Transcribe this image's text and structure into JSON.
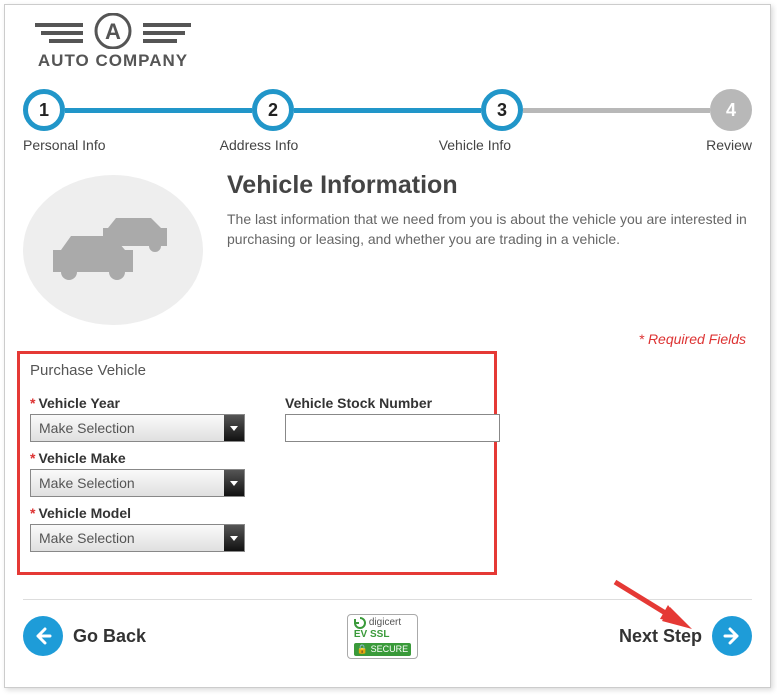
{
  "logo": {
    "text": "AUTO COMPANY"
  },
  "stepper": {
    "steps": [
      {
        "num": "1",
        "label": "Personal Info",
        "active": true
      },
      {
        "num": "2",
        "label": "Address Info",
        "active": true
      },
      {
        "num": "3",
        "label": "Vehicle Info",
        "active": true
      },
      {
        "num": "4",
        "label": "Review",
        "active": false
      }
    ]
  },
  "heading": "Vehicle Information",
  "description": "The last information that we need from you is about the vehicle you are interested in purchasing or leasing, and whether you are trading in a vehicle.",
  "required_note": "* Required Fields",
  "form": {
    "section_title": "Purchase Vehicle",
    "year": {
      "label": "Vehicle Year",
      "value": "Make Selection"
    },
    "make": {
      "label": "Vehicle Make",
      "value": "Make Selection"
    },
    "model": {
      "label": "Vehicle Model",
      "value": "Make Selection"
    },
    "stock": {
      "label": "Vehicle Stock Number",
      "value": ""
    }
  },
  "nav": {
    "back": "Go Back",
    "next": "Next Step"
  },
  "badge": {
    "brand": "digicert",
    "line2": "EV SSL",
    "secure": "SECURE"
  }
}
